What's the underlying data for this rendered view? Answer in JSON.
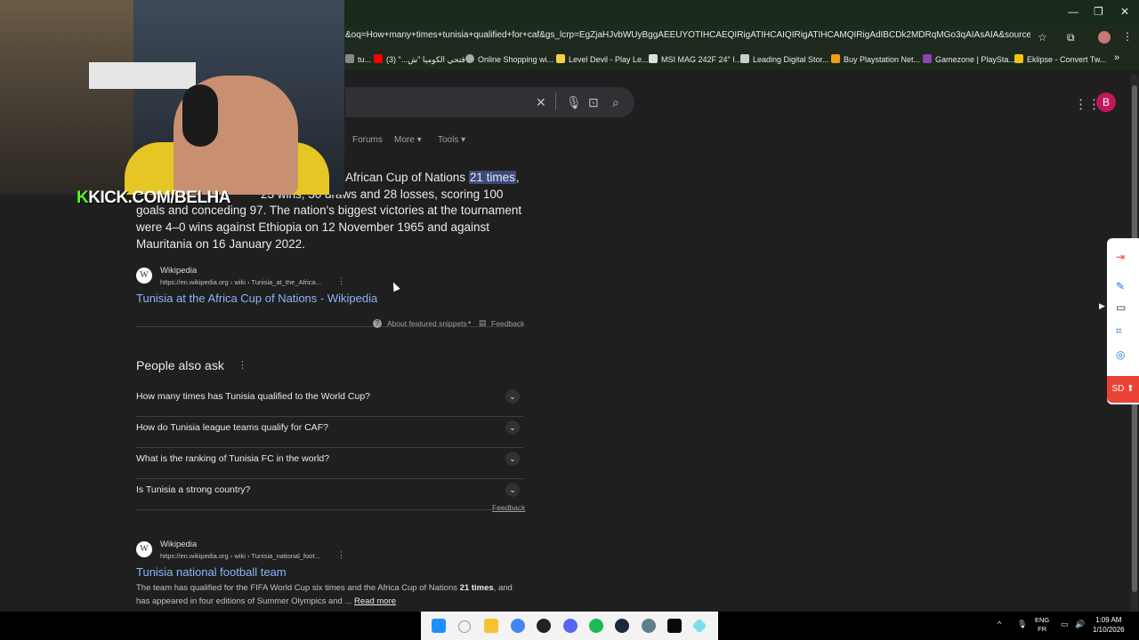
{
  "browser": {
    "url": "&oq=How+many+times+tunisia+qualified+for+caf&gs_lcrp=EgZjaHJvbWUyBggAEEUYOTIHCAEQIRigATIHCAIQIRigATIHCAMQIRigAdIBCDk2MDRqMGo3qAIAsAIA&sourceid=chrome&i...",
    "window_min": "—",
    "window_max": "❐",
    "window_close": "✕",
    "bookmarks": [
      {
        "label": "tu...",
        "color": "#888888"
      },
      {
        "label": "فتحي الكوميا \"ش...\" (3)",
        "color": "#ff0000"
      },
      {
        "label": "Online Shopping wi...",
        "color": "#aaaaaa"
      },
      {
        "label": "Level Devil - Play Le...",
        "color": "#f4d03f"
      },
      {
        "label": "MSI MAG 242F 24\" I...",
        "color": "#dddddd"
      },
      {
        "label": "Leading Digital Stor...",
        "color": "#cccccc"
      },
      {
        "label": "Buy Playstation Net...",
        "color": "#f39c12"
      },
      {
        "label": "Gamezone | PlaySta...",
        "color": "#8e44ad"
      },
      {
        "label": "Eklipse - Convert Tw...",
        "color": "#f1c40f"
      }
    ],
    "bookmarks_more": "»"
  },
  "google": {
    "avatar_letter": "B",
    "tabs": [
      "Forums",
      "More",
      "Tools"
    ],
    "snippet": {
      "line1_prefix": "African Cup of Nations ",
      "highlight": "21 times",
      "line1_suffix": ",",
      "line2_visible": "23 wins, 30 draws and 28 losses, scoring 100",
      "rest": "goals and conceding 97. The nation's biggest victories at the tournament were 4–0 wins against Ethiopia on 12 November 1965 and against Mauritania on 16 January 2022."
    },
    "result1": {
      "source": "Wikipedia",
      "url": "https://en.wikipedia.org › wiki › Tunisia_at_the_Africa...",
      "title": "Tunisia at the Africa Cup of Nations - Wikipedia"
    },
    "about_snippets": "About featured snippets",
    "feedback": "Feedback",
    "paa": {
      "title": "People also ask",
      "questions": [
        "How many times has Tunisia qualified to the World Cup?",
        "How do Tunisia league teams qualify for CAF?",
        "What is the ranking of Tunisia FC in the world?",
        "Is Tunisia a strong country?"
      ],
      "feedback": "Feedback"
    },
    "result2": {
      "source": "Wikipedia",
      "url": "https://en.wikipedia.org › wiki › Tunisia_national_foot...",
      "title": "Tunisia national football team",
      "desc_before": "The team has qualified for the FIFA World Cup six times and the Africa Cup of Nations ",
      "desc_bold": "21 times",
      "desc_after": ", and has appeared in four editions of Summer Olympics and ... ",
      "read_more": "Read more"
    }
  },
  "overlay": {
    "kick_k": "K",
    "kick_text": "KICK.COM/BELHA"
  },
  "sidebar": {
    "sd_label": "SD"
  },
  "taskbar": {
    "lang_top": "ENG",
    "lang_bottom": "FR",
    "time": "1:09 AM",
    "date": "1/10/2026"
  }
}
